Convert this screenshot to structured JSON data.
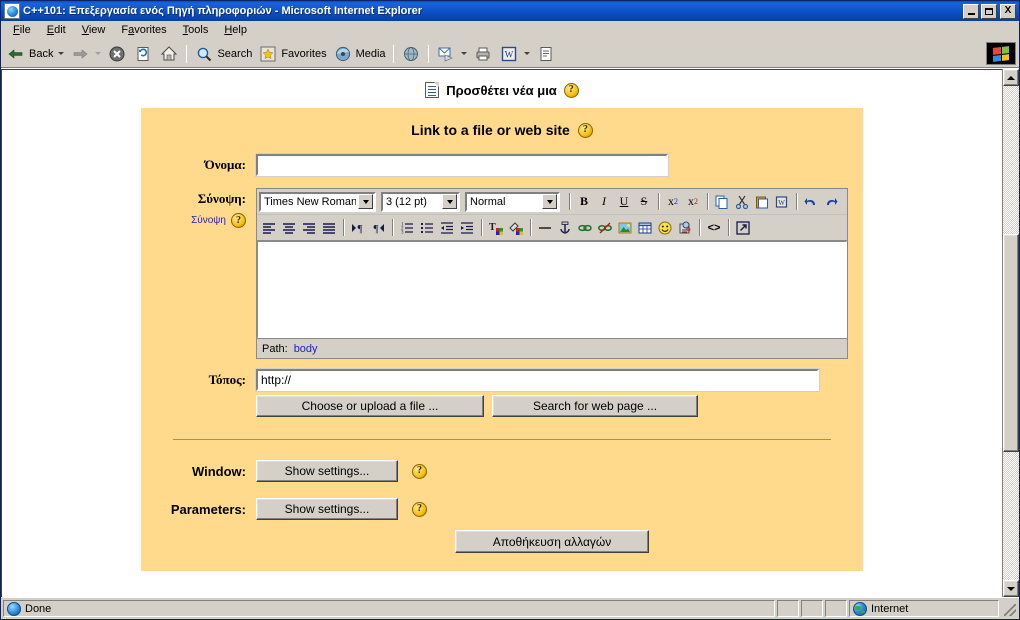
{
  "window": {
    "title": "C++101: Επεξεργασία ενός Πηγή πληροφοριών - Microsoft Internet Explorer",
    "minimize_label": "Minimize",
    "maximize_label": "Maximize",
    "close_label": "X"
  },
  "menubar": [
    {
      "label": "File",
      "accel": "F"
    },
    {
      "label": "Edit",
      "accel": "E"
    },
    {
      "label": "View",
      "accel": "V"
    },
    {
      "label": "Favorites",
      "accel": "a"
    },
    {
      "label": "Tools",
      "accel": "T"
    },
    {
      "label": "Help",
      "accel": "H"
    }
  ],
  "toolbar": {
    "back": "Back",
    "forward": "",
    "stop": "",
    "refresh": "",
    "home": "",
    "search": "Search",
    "favorites": "Favorites",
    "media": "Media",
    "history": "",
    "mail": "",
    "print": "",
    "edit_word": "",
    "discuss": ""
  },
  "document": {
    "heading": "Προσθέτει νέα μια",
    "help_glyph": "?"
  },
  "form": {
    "panel_title": "Link to a file or web site",
    "name_label": "Όνομα:",
    "name_value": "",
    "summary_label": "Σύνοψη:",
    "summary_sub_label": "Σύνοψη",
    "location_label": "Τόπος:",
    "location_value": "http://",
    "choose_file_button": "Choose or upload a file ...",
    "search_web_button": "Search for web page ...",
    "window_label": "Window:",
    "window_button": "Show settings...",
    "parameters_label": "Parameters:",
    "parameters_button": "Show settings...",
    "save_button": "Αποθήκευση αλλαγών"
  },
  "editor": {
    "font_family": "Times New Roman",
    "font_size": "3 (12 pt)",
    "paragraph_style": "Normal",
    "content": "",
    "path_label": "Path:",
    "path_value": "body",
    "row1_buttons": [
      {
        "name": "bold",
        "glyph": "B"
      },
      {
        "name": "italic",
        "glyph": "I"
      },
      {
        "name": "underline",
        "glyph": "U"
      },
      {
        "name": "strikethrough",
        "glyph": "S"
      },
      {
        "name": "subscript",
        "glyph": "x₂"
      },
      {
        "name": "superscript",
        "glyph": "x²"
      },
      {
        "name": "copy",
        "glyph": "⎘"
      },
      {
        "name": "cut",
        "glyph": "✂"
      },
      {
        "name": "paste",
        "glyph": "📋"
      },
      {
        "name": "paste-from-word",
        "glyph": "W"
      },
      {
        "name": "undo",
        "glyph": "↶"
      },
      {
        "name": "redo",
        "glyph": "↷"
      }
    ],
    "row2_buttons": [
      {
        "name": "align-left",
        "glyph": "≡"
      },
      {
        "name": "align-center",
        "glyph": "≡"
      },
      {
        "name": "align-right",
        "glyph": "≡"
      },
      {
        "name": "align-justify",
        "glyph": "≡"
      },
      {
        "name": "direction-ltr",
        "glyph": "▶¶"
      },
      {
        "name": "direction-rtl",
        "glyph": "¶◀"
      },
      {
        "name": "ordered-list",
        "glyph": "⒈"
      },
      {
        "name": "unordered-list",
        "glyph": "•"
      },
      {
        "name": "outdent",
        "glyph": "⇤"
      },
      {
        "name": "indent",
        "glyph": "⇥"
      },
      {
        "name": "text-color",
        "glyph": "T"
      },
      {
        "name": "background-color",
        "glyph": "◧"
      },
      {
        "name": "horizontal-rule",
        "glyph": "—"
      },
      {
        "name": "anchor",
        "glyph": "⚓"
      },
      {
        "name": "insert-link",
        "glyph": "🔗"
      },
      {
        "name": "unlink",
        "glyph": "⛓"
      },
      {
        "name": "insert-image",
        "glyph": "🖼"
      },
      {
        "name": "insert-table",
        "glyph": "▦"
      },
      {
        "name": "insert-emoticon",
        "glyph": "☺"
      },
      {
        "name": "special-character",
        "glyph": "Ω"
      },
      {
        "name": "html-source",
        "glyph": "<>"
      },
      {
        "name": "fullscreen",
        "glyph": "⤢"
      }
    ]
  },
  "statusbar": {
    "message": "Done",
    "zone": "Internet"
  },
  "colors": {
    "panel_background": "#ffd98c",
    "title_bar": "#0b50c4",
    "chrome": "#d4d0c8",
    "link": "#2222cc"
  }
}
